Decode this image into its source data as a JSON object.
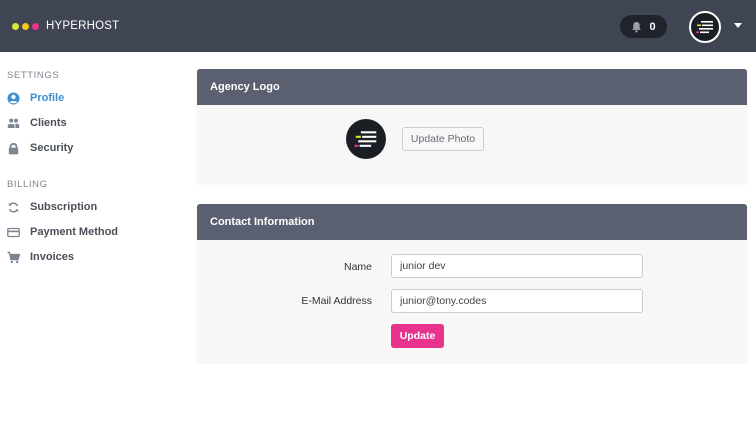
{
  "app": {
    "brand_name": "HYPERHOST",
    "brand_dot_colors": [
      "#d7e637",
      "#f5c518",
      "#e8338c"
    ]
  },
  "header": {
    "notification_count": "0",
    "notification_icon": "bell-icon",
    "user_menu_icon": "caret-down-icon"
  },
  "sidebar": {
    "settings_title": "SETTINGS",
    "billing_title": "BILLING",
    "settings_items": [
      {
        "label": "Profile",
        "icon": "user-circle-icon",
        "active": true
      },
      {
        "label": "Clients",
        "icon": "users-icon",
        "active": false
      },
      {
        "label": "Security",
        "icon": "lock-icon",
        "active": false
      }
    ],
    "billing_items": [
      {
        "label": "Subscription",
        "icon": "refresh-icon",
        "active": false
      },
      {
        "label": "Payment Method",
        "icon": "credit-card-icon",
        "active": false
      },
      {
        "label": "Invoices",
        "icon": "cart-icon",
        "active": false
      }
    ]
  },
  "agency_logo": {
    "title": "Agency Logo",
    "update_photo_label": "Update Photo"
  },
  "contact": {
    "title": "Contact Information",
    "name_label": "Name",
    "name_value": "junior dev",
    "email_label": "E-Mail Address",
    "email_value": "junior@tony.codes",
    "update_label": "Update"
  },
  "colors": {
    "topbar": "#3f4553",
    "panel_header": "#5b6070",
    "active_link": "#3c8fd1",
    "primary_button": "#e8338c"
  }
}
